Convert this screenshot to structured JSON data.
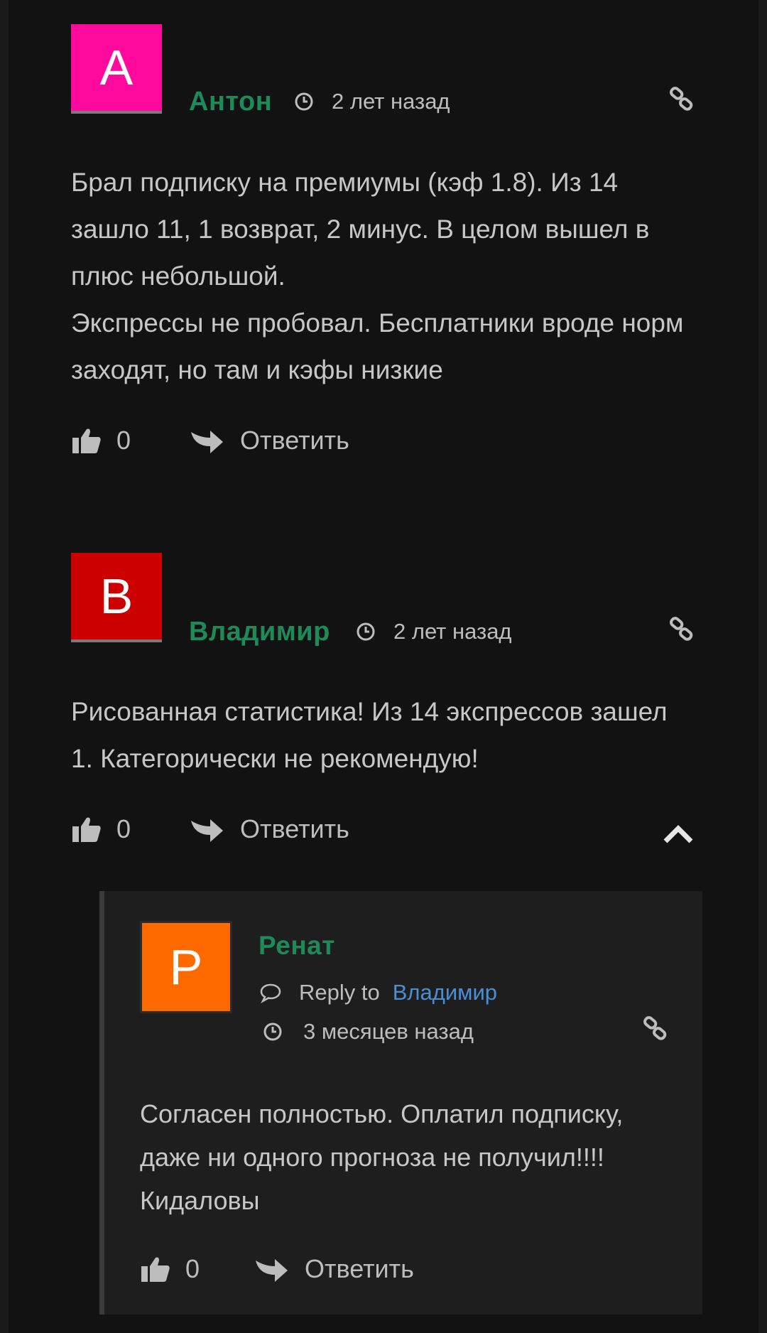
{
  "comments": [
    {
      "avatar_letter": "А",
      "avatar_color": "#ff0a9c",
      "author": "Антон",
      "time": "2 лет назад",
      "text": "Брал подписку на премиумы (кэф 1.8). Из 14 зашло 11, 1 возврат, 2 минус. В целом вышел в плюс небольшой.",
      "text2": "Экспрессы не пробовал. Бесплатники вроде норм заходят, но там и кэфы низкие",
      "likes": "0",
      "reply_label": "Ответить"
    },
    {
      "avatar_letter": "В",
      "avatar_color": "#cc0000",
      "author": "Владимир",
      "time": "2 лет назад",
      "text": "Рисованная статистика! Из 14 экспрессов зашел 1. Категорически не рекомендую!",
      "likes": "0",
      "reply_label": "Ответить"
    }
  ],
  "reply": {
    "avatar_letter": "Р",
    "avatar_color": "#ff6a00",
    "author": "Ренат",
    "reply_to_label": "Reply to",
    "reply_to_name": "Владимир",
    "time": "3 месяцев назад",
    "text": "Согласен полностью. Оплатил подписку, даже ни одного прогноза не получил!!!! Кидаловы",
    "likes": "0",
    "reply_label": "Ответить"
  },
  "icons": {
    "clock": "clock-icon",
    "link": "link-icon",
    "like": "thumbs-up-icon",
    "reply": "reply-arrow-icon",
    "collapse": "chevron-up-icon",
    "speech": "speech-bubble-icon"
  }
}
